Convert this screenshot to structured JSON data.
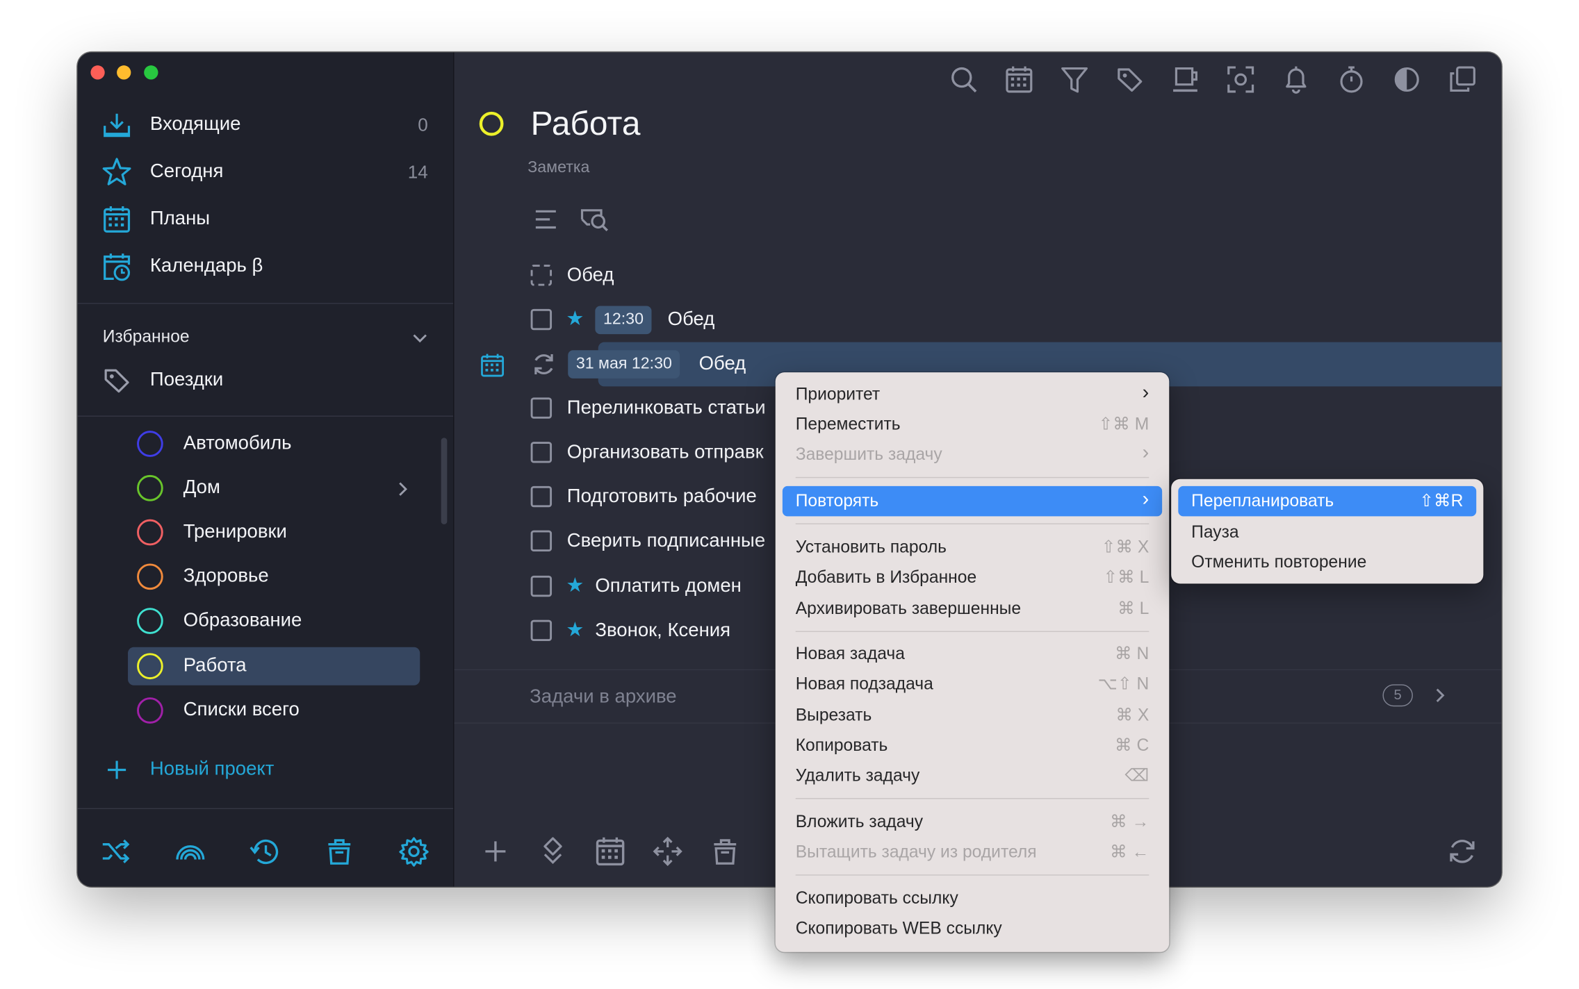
{
  "sidebar": {
    "nav": [
      {
        "label": "Входящие",
        "count": "0",
        "icon": "inbox-icon"
      },
      {
        "label": "Сегодня",
        "count": "14",
        "icon": "star-icon"
      },
      {
        "label": "Планы",
        "count": "",
        "icon": "calendar-grid-icon"
      },
      {
        "label": "Календарь β",
        "count": "",
        "icon": "calendar-clock-icon"
      }
    ],
    "favorites_header": "Избранное",
    "favorites": [
      {
        "label": "Поездки",
        "icon": "tag-icon"
      }
    ],
    "projects": [
      {
        "label": "Автомобиль",
        "color": "#3f3de6"
      },
      {
        "label": "Дом",
        "color": "#69c52b"
      },
      {
        "label": "Тренировки",
        "color": "#f06063"
      },
      {
        "label": "Здоровье",
        "color": "#f08a3c"
      },
      {
        "label": "Образование",
        "color": "#3fe0d0"
      },
      {
        "label": "Работа",
        "color": "#ecf02a"
      },
      {
        "label": "Списки всего",
        "color": "#a020a8"
      }
    ],
    "new_project": "Новый проект",
    "bottom_icons": [
      "shuffle-icon",
      "rainbow-icon",
      "history-icon",
      "trash-icon",
      "settings-icon"
    ]
  },
  "main": {
    "title": "Работа",
    "note": "Заметка",
    "title_ring_color": "#ecf02a",
    "toolbar_icons": [
      "search-icon",
      "calendar-icon",
      "filter-icon",
      "tag-icon",
      "coffee-icon",
      "focus-icon",
      "bell-icon",
      "timer-icon",
      "contrast-icon",
      "copy-window-icon"
    ],
    "tasks": [
      {
        "text": "Обед"
      },
      {
        "text": "Обед",
        "time": "12:30"
      },
      {
        "text": "Обед",
        "date": "31 мая 12:30"
      },
      {
        "text": "Перелинковать статьи"
      },
      {
        "text": "Организовать отправк"
      },
      {
        "text": "Подготовить рабочие"
      },
      {
        "text": "Сверить подписанные"
      },
      {
        "text": "Оплатить домен"
      },
      {
        "text": "Звонок, Ксения"
      }
    ],
    "archive_label": "Задачи в архиве",
    "archive_count": "5",
    "bottom_icons": [
      "add-icon",
      "sort-icon",
      "calendar-icon",
      "move-icon",
      "trash-icon",
      "sync-icon"
    ]
  },
  "context_menu": {
    "items": [
      {
        "label": "Приоритет",
        "shortcut": "›"
      },
      {
        "label": "Переместить",
        "shortcut": "⇧⌘ M"
      },
      {
        "label": "Завершить задачу",
        "shortcut": "›"
      },
      {
        "label": "Повторять",
        "shortcut": "›"
      },
      {
        "label": "Установить пароль",
        "shortcut": "⇧⌘ X"
      },
      {
        "label": "Добавить в Избранное",
        "shortcut": "⇧⌘ L"
      },
      {
        "label": "Архивировать завершенные",
        "shortcut": "⌘ L"
      },
      {
        "label": "Новая задача",
        "shortcut": "⌘ N"
      },
      {
        "label": "Новая подзадача",
        "shortcut": "⌥⇧ N"
      },
      {
        "label": "Вырезать",
        "shortcut": "⌘ X"
      },
      {
        "label": "Копировать",
        "shortcut": "⌘ C"
      },
      {
        "label": "Удалить задачу",
        "shortcut": "⌫"
      },
      {
        "label": "Вложить задачу",
        "shortcut": "⌘ →"
      },
      {
        "label": "Вытащить задачу из родителя",
        "shortcut": "⌘ ←"
      },
      {
        "label": "Скопировать ссылку",
        "shortcut": ""
      },
      {
        "label": "Скопировать WEB ссылку",
        "shortcut": ""
      }
    ],
    "submenu": [
      {
        "label": "Перепланировать",
        "shortcut": "⇧⌘R"
      },
      {
        "label": "Пауза",
        "shortcut": ""
      },
      {
        "label": "Отменить повторение",
        "shortcut": ""
      }
    ]
  },
  "colors": {
    "accent": "#24a8d8",
    "selection": "#3d8cf6",
    "sidebar_bg": "#1f212b",
    "main_bg": "#2a2c38"
  }
}
